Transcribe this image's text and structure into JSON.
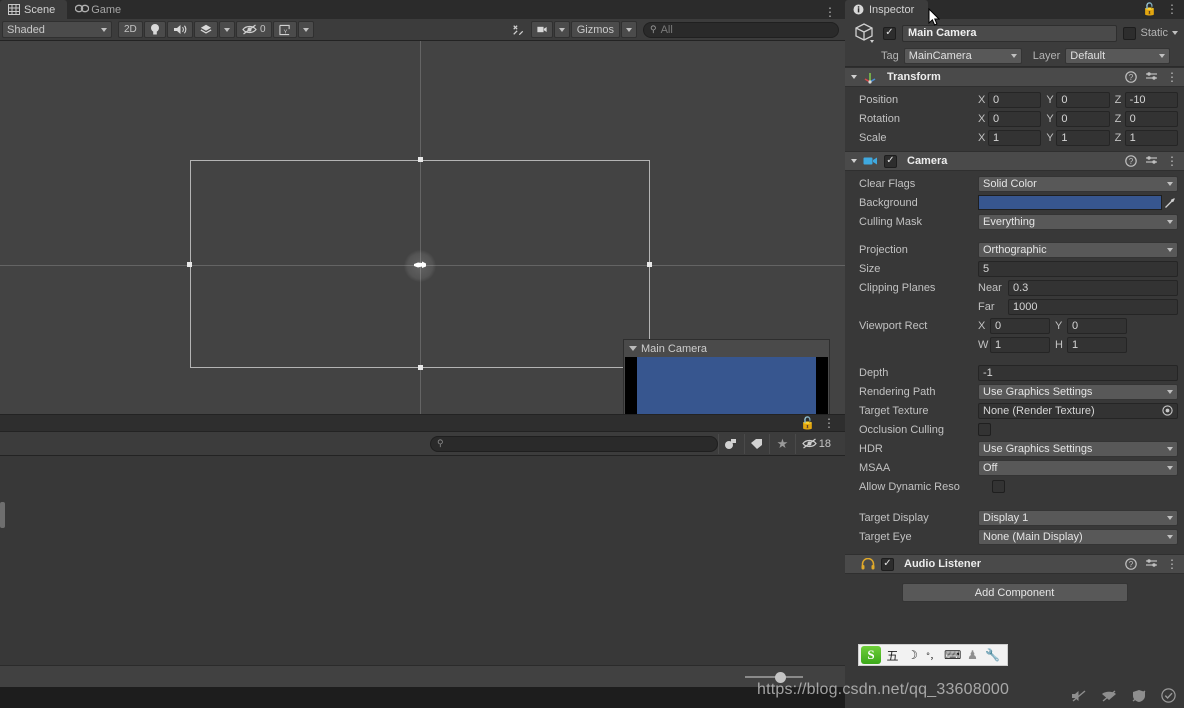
{
  "scene_panel": {
    "tabs": [
      {
        "label": "Scene",
        "icon": "grid-icon",
        "active": true
      },
      {
        "label": "Game",
        "icon": "gamepad-icon",
        "active": false
      }
    ],
    "toolbar": {
      "draw_mode": "Shaded",
      "toggle_2d": "2D",
      "lighting_icon": "lightbulb-icon",
      "audio_icon": "speaker-icon",
      "fx_icon": "effects-icon",
      "hidden_objects_icon": "eye-off-icon",
      "hidden_objects_count": "0",
      "grid_icon": "grid-snap-icon",
      "tools_icon": "tools-icon",
      "camera_icon": "scene-camera-icon",
      "gizmos_label": "Gizmos",
      "search_placeholder": "All",
      "search_value": ""
    },
    "overlay": {
      "camera_preview_title": "Main Camera",
      "preview_background_color": "#37568f"
    },
    "lockbar": {
      "lock_icon": "lock-icon",
      "menu_icon": "kebab-menu-icon"
    }
  },
  "project_panel": {
    "search_placeholder": "",
    "search_value": "",
    "icons": [
      {
        "name": "favorite-filter-icon",
        "glyph": "⚈"
      },
      {
        "name": "label-filter-icon",
        "glyph": "⚑"
      },
      {
        "name": "star-filter-icon",
        "glyph": "★"
      }
    ],
    "hidden_count_icon": "eye-off-icon",
    "hidden_count": "18",
    "zoom_slider_value": 52
  },
  "inspector": {
    "tab_label": "Inspector",
    "tab_icon": "info-icon",
    "lock_icon": "lock-icon",
    "menu_icon": "kebab-menu-icon",
    "object": {
      "enabled": true,
      "name": "Main Camera",
      "prefab_icon": "cube-icon",
      "static_label": "Static",
      "static_checked": false,
      "tag_label": "Tag",
      "tag_value": "MainCamera",
      "layer_label": "Layer",
      "layer_value": "Default"
    },
    "components": [
      {
        "name": "Transform",
        "icon": "transform-icon",
        "has_checkbox": false,
        "help_icon": "help-icon",
        "preset_icon": "preset-icon",
        "menu_icon": "kebab-menu-icon",
        "rows": [
          {
            "type": "vector3",
            "label": "Position",
            "x": "0",
            "y": "0",
            "z": "-10"
          },
          {
            "type": "vector3",
            "label": "Rotation",
            "x": "0",
            "y": "0",
            "z": "0"
          },
          {
            "type": "vector3",
            "label": "Scale",
            "x": "1",
            "y": "1",
            "z": "1"
          }
        ]
      },
      {
        "name": "Camera",
        "icon": "camera-icon",
        "has_checkbox": true,
        "checked": true,
        "help_icon": "help-icon",
        "preset_icon": "preset-icon",
        "menu_icon": "kebab-menu-icon",
        "rows": [
          {
            "type": "dropdown",
            "label": "Clear Flags",
            "value": "Solid Color"
          },
          {
            "type": "color",
            "label": "Background",
            "value": "#37568f",
            "picker_icon": "eyedropper-icon"
          },
          {
            "type": "dropdown",
            "label": "Culling Mask",
            "value": "Everything"
          },
          {
            "type": "gap"
          },
          {
            "type": "dropdown",
            "label": "Projection",
            "value": "Orthographic"
          },
          {
            "type": "text",
            "label": "Size",
            "value": "5"
          },
          {
            "type": "named",
            "label": "Clipping Planes",
            "sub": "Near",
            "value": "0.3"
          },
          {
            "type": "named",
            "label": "",
            "sub": "Far",
            "value": "1000"
          },
          {
            "type": "rect",
            "label": "Viewport Rect",
            "x": "0",
            "y": "0",
            "w": "1",
            "h": "1"
          },
          {
            "type": "gap"
          },
          {
            "type": "text",
            "label": "Depth",
            "value": "-1"
          },
          {
            "type": "dropdown",
            "label": "Rendering Path",
            "value": "Use Graphics Settings"
          },
          {
            "type": "object",
            "label": "Target Texture",
            "value": "None (Render Texture)",
            "select_icon": "target-select-icon"
          },
          {
            "type": "checkbox",
            "label": "Occlusion Culling",
            "checked": false
          },
          {
            "type": "dropdown",
            "label": "HDR",
            "value": "Use Graphics Settings"
          },
          {
            "type": "dropdown",
            "label": "MSAA",
            "value": "Off"
          },
          {
            "type": "checkbox",
            "label": "Allow Dynamic Reso",
            "checked": false
          },
          {
            "type": "gap"
          },
          {
            "type": "dropdown",
            "label": "Target Display",
            "value": "Display 1"
          },
          {
            "type": "dropdown",
            "label": "Target Eye",
            "value": "None (Main Display)"
          }
        ]
      },
      {
        "name": "Audio Listener",
        "icon": "headphones-icon",
        "has_checkbox": true,
        "checked": true,
        "help_icon": "help-icon",
        "preset_icon": "preset-icon",
        "menu_icon": "kebab-menu-icon",
        "rows": []
      }
    ],
    "add_component_label": "Add Component"
  },
  "ime": {
    "logo": "S",
    "buttons": [
      {
        "name": "input-mode-wubi",
        "glyph": "五"
      },
      {
        "name": "half-width-moon-icon",
        "glyph": "☽"
      },
      {
        "name": "punctuation-icon",
        "glyph": "°，"
      },
      {
        "name": "soft-keyboard-icon",
        "glyph": "⌨"
      },
      {
        "name": "user-icon",
        "glyph": "♟"
      },
      {
        "name": "settings-wrench-icon",
        "glyph": "🔧"
      }
    ]
  },
  "watermark": {
    "text": "https://blog.csdn.net/qq_33608000"
  },
  "tray": {
    "icons": [
      {
        "name": "volume-muted-icon",
        "glyph": "✕"
      },
      {
        "name": "network-icon",
        "glyph": "✕"
      },
      {
        "name": "shield-icon",
        "glyph": "✕"
      },
      {
        "name": "check-circle-icon",
        "glyph": "✓"
      }
    ]
  }
}
